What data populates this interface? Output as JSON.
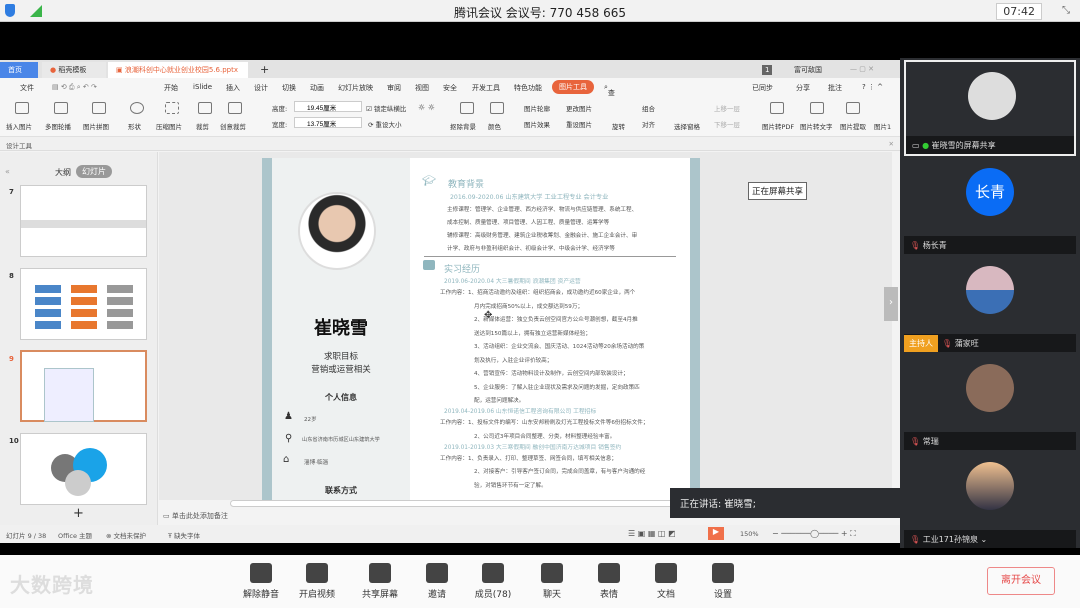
{
  "meeting": {
    "title": "腾讯会议 会议号: 770 458 665",
    "time": "07:42"
  },
  "wps": {
    "tabs": [
      "首页",
      "稻壳模板",
      "浪潮科创中心就业创业校园5.6.pptx"
    ],
    "account": "富可敌国",
    "account_badge": "1",
    "menu": [
      "文件",
      "开始",
      "iSlide",
      "插入",
      "设计",
      "切换",
      "动画",
      "幻灯片放映",
      "审阅",
      "视图",
      "安全",
      "开发工具",
      "特色功能",
      "图片工具",
      "查找"
    ],
    "menu_right": [
      "已同步",
      "分享",
      "批注"
    ],
    "ribbon": {
      "insert_image": "插入图片",
      "multi_carousel": "多图轮播",
      "image_collage": "图片拼图",
      "shape": "形状",
      "compress": "压缩图片",
      "crop": "裁剪",
      "creative_crop": "创意裁剪",
      "height_label": "高度:",
      "height": "19.45厘米",
      "width_label": "宽度:",
      "width": "13.75厘米",
      "lock_ratio": "锁定纵横比",
      "reset_size": "重设大小",
      "remove_bg": "抠除背景",
      "color": "颜色",
      "outline": "图片轮廓",
      "effects": "图片效果",
      "change": "更改图片",
      "reset": "重设图片",
      "rotate": "旋转",
      "group": "组合",
      "align": "对齐",
      "selection": "选择窗格",
      "bring_forward": "上移一层",
      "send_backward": "下移一层",
      "to_pdf": "图片转PDF",
      "to_text": "图片转文字",
      "extract": "图片提取",
      "more": "图片1"
    },
    "design_tools": "设计工具",
    "panel": {
      "outline": "大纲",
      "slides": "幻灯片",
      "numbers": [
        "7",
        "8",
        "9",
        "10"
      ]
    },
    "notes": "单击此处添加备注",
    "status": {
      "slide": "幻灯片 9 / 38",
      "theme": "Office 主题",
      "protect": "文档未保护",
      "font": "缺失字体",
      "zoom": "150%"
    },
    "sharing": "正在屏幕共享",
    "speaking": "正在讲话: 崔晓雪;"
  },
  "resume": {
    "name": "崔晓雪",
    "goal_label": "求职目标",
    "goal": "营销或运营相关",
    "info_title": "个人信息",
    "age": "22岁",
    "address": "山东省济南市历城区山东建筑大学",
    "hometown": "淄博·临淄",
    "contact_title": "联系方式",
    "edu_title": "教育背景",
    "edu_line": "2016.09-2020.06   山东建筑大学   工业工程专业   会计专业",
    "edu": [
      "主修课程：管理学、企业管理、西方经济学、物流与供应链管理、系统工程、",
      "成本控制、质量管理、项目管理、人因工程、质量管理、运筹学等",
      "辅修课程：高级财务管理、建筑企业税收筹划、金融会计、施工企业会计、审",
      "计学、政府与非盈利组织会计、初级会计学、中级会计学、经济学等"
    ],
    "exp_title": "实习经历",
    "exp": [
      {
        "head": "2019.06-2020.04    大三暑假期间    浪潮集团    资产运营",
        "lines": [
          "工作内容：1、招商活动邀约及组织：组织招商会，成功邀约近60家企业，两个",
          "月内完成招商50%以上，成交额达到59万；",
          "2、新媒体运营：独立负责云创空间官方公众号潮创想，截至4月推",
          "送达到150篇以上，拥有独立运营新媒体经验；",
          "3、活动组织：企业交流会、国庆活动、1024活动等20余场活动的策",
          "划及执行，入驻企业评价较高；",
          "4、营销宣传：活动物料设计及制作，云创空间内部软装设计；",
          "5、企业服务：了解入驻企业现状及需求及问题的发掘，定向政策匹",
          "配，运营问题解决。"
        ]
      },
      {
        "head": "2019.04-2019.06    山东恒诺信工程咨询有限公司     工程招标",
        "lines": [
          "工作内容：1、投标文件的编写：山东安邦粉刷及灯光工程投标文件等6份招标文件；",
          "2、公司近3年项目合同整理、分类，材料整理经验丰富。"
        ]
      },
      {
        "head": "2019.01-2019.03    大三寒假期间    融创中国济南万达城项目    销售签约",
        "lines": [
          "工作内容：1、负责录入、打印、整理草签、网签合同，填写相关信息；",
          "2、对接客户：引导客户签订合同，完成合同盖章，有与客户沟通的经",
          "验，对销售环节有一定了解。"
        ]
      }
    ]
  },
  "participants": [
    {
      "name": "崔晓雪的屏幕共享",
      "mic": "on"
    },
    {
      "name": "杨长青",
      "avatar_text": "长青",
      "mic": "muted"
    },
    {
      "name": "蒲家旺",
      "badge": "主持人",
      "mic": "muted"
    },
    {
      "name": "常瑞",
      "mic": "muted"
    },
    {
      "name": "工业171孙锦泉",
      "mic": "muted"
    }
  ],
  "toolbar": {
    "brand": "大数跨境",
    "items": [
      "解除静音",
      "开启视频",
      "共享屏幕",
      "邀请",
      "成员(78)",
      "聊天",
      "表情",
      "文档",
      "设置"
    ],
    "leave": "离开会议"
  },
  "colors": {
    "accent_blue": "#1a73e8",
    "wps_orange": "#e8643c",
    "leave_red": "#e64a4a",
    "host_orange": "#f0a020"
  }
}
